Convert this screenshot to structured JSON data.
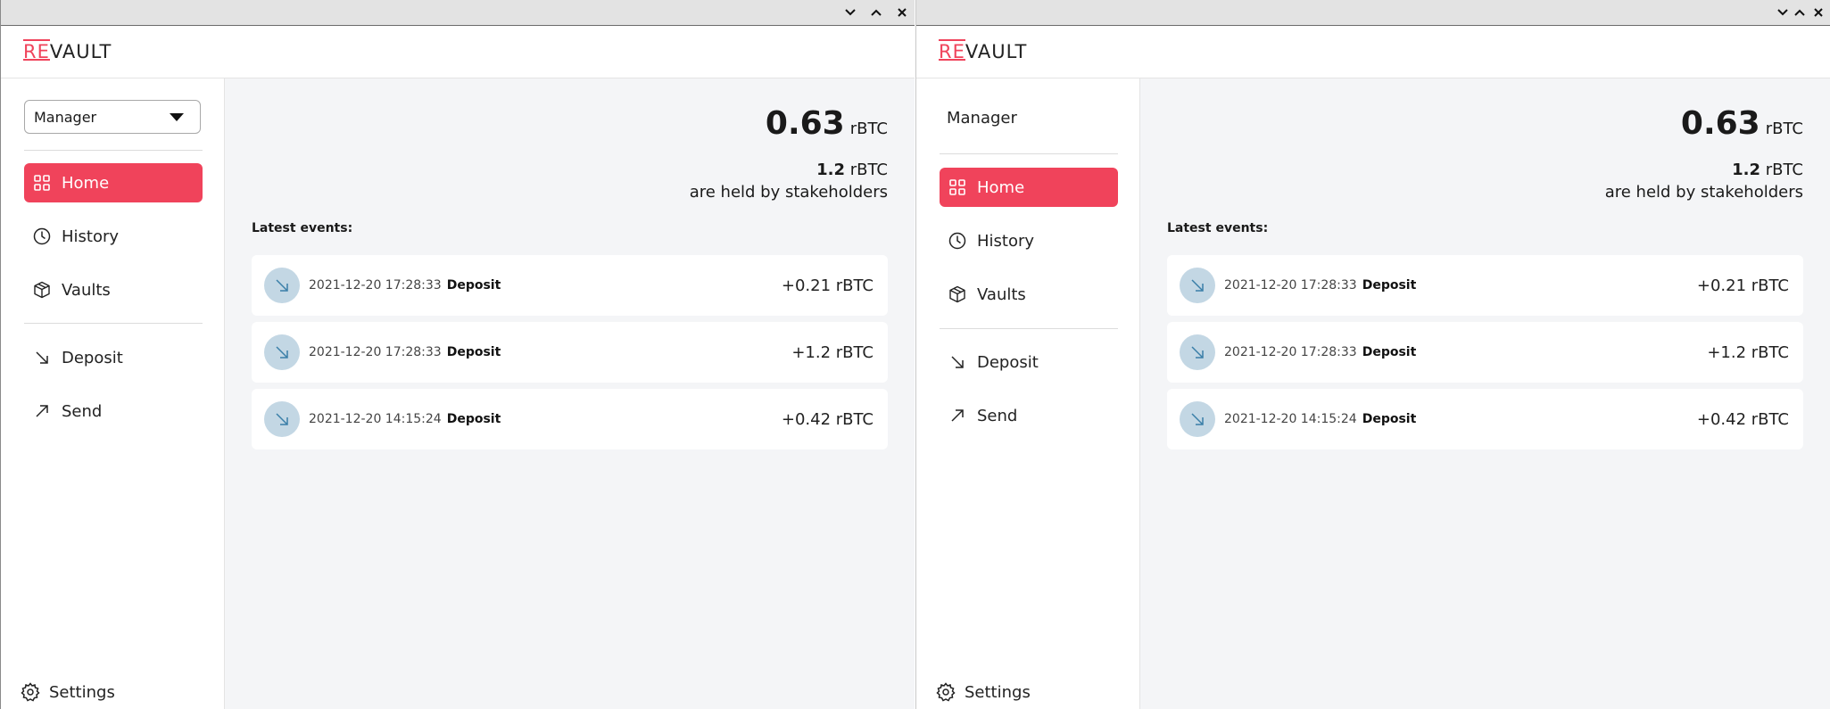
{
  "colors": {
    "accent": "#f0435b",
    "event_icon_bg": "#c3d7e4",
    "event_icon_arrow": "#3a7fa8"
  },
  "logo": {
    "prefix": "RE",
    "suffix": "VAULT"
  },
  "windows": [
    {
      "role_select": {
        "value": "Manager"
      },
      "nav": {
        "home": "Home",
        "history": "History",
        "vaults": "Vaults",
        "deposit": "Deposit",
        "send": "Send",
        "settings": "Settings"
      },
      "balance": {
        "amount": "0.63",
        "unit": "rBTC"
      },
      "held": {
        "amount": "1.2",
        "unit": "rBTC",
        "text": "are held by stakeholders"
      },
      "events_title": "Latest events:",
      "events": [
        {
          "date": "2021-12-20 17:28:33",
          "type": "Deposit",
          "amount": "+0.21 rBTC"
        },
        {
          "date": "2021-12-20 17:28:33",
          "type": "Deposit",
          "amount": "+1.2 rBTC"
        },
        {
          "date": "2021-12-20 14:15:24",
          "type": "Deposit",
          "amount": "+0.42 rBTC"
        }
      ]
    },
    {
      "role_label": "Manager",
      "nav": {
        "home": "Home",
        "history": "History",
        "vaults": "Vaults",
        "deposit": "Deposit",
        "send": "Send",
        "settings": "Settings"
      },
      "balance": {
        "amount": "0.63",
        "unit": "rBTC"
      },
      "held": {
        "amount": "1.2",
        "unit": "rBTC",
        "text": "are held by stakeholders"
      },
      "events_title": "Latest events:",
      "events": [
        {
          "date": "2021-12-20 17:28:33",
          "type": "Deposit",
          "amount": "+0.21 rBTC"
        },
        {
          "date": "2021-12-20 17:28:33",
          "type": "Deposit",
          "amount": "+1.2 rBTC"
        },
        {
          "date": "2021-12-20 14:15:24",
          "type": "Deposit",
          "amount": "+0.42 rBTC"
        }
      ]
    }
  ]
}
